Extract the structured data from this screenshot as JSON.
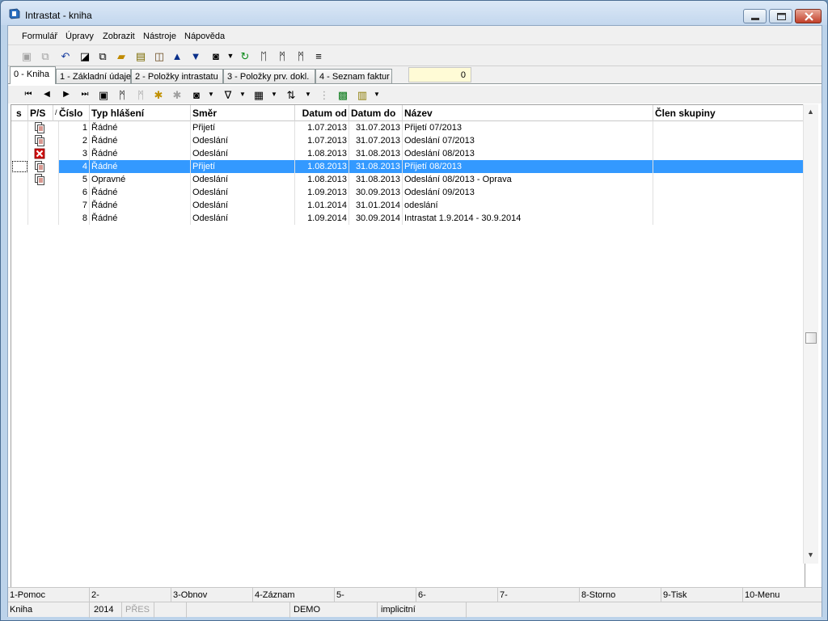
{
  "window": {
    "title": "Intrastat - kniha"
  },
  "menu": [
    "Formulář",
    "Úpravy",
    "Zobrazit",
    "Nástroje",
    "Nápověda"
  ],
  "tabs": [
    {
      "label": "0 - Kniha",
      "active": true
    },
    {
      "label": "1 - Základní údaje",
      "active": false
    },
    {
      "label": "2 - Položky intrastatu",
      "active": false
    },
    {
      "label": "3 - Položky prv. dokl.",
      "active": false
    },
    {
      "label": "4 - Seznam faktur",
      "active": false
    }
  ],
  "record_counter": "0",
  "toolbar_icons": [
    "save-icon",
    "save-all-icon",
    "undo-icon",
    "new-record-icon",
    "copy-record-icon",
    "open-folder-icon",
    "lock-icon",
    "book-icon",
    "arrow-up-icon",
    "arrow-down-icon",
    "camera-icon",
    "dropdown-icon",
    "refresh-icon",
    "binoculars-icon",
    "binoculars-next-icon",
    "binoculars-prev-icon",
    "list-icon"
  ],
  "grid": {
    "columns": [
      "s",
      "P/S",
      "Číslo",
      "Typ hlášení",
      "Směr",
      "Datum od",
      "Datum do",
      "Název",
      "Člen skupiny"
    ],
    "sort_marker": "/",
    "rows": [
      {
        "icon": "document-icon",
        "cislo": "1",
        "typ": "Řádné",
        "smer": "Přijetí",
        "od": "1.07.2013",
        "do": "31.07.2013",
        "nazev": "Přijetí 07/2013",
        "clen": "",
        "selected": false
      },
      {
        "icon": "document-icon",
        "cislo": "2",
        "typ": "Řádné",
        "smer": "Odeslání",
        "od": "1.07.2013",
        "do": "31.07.2013",
        "nazev": "Odeslání 07/2013",
        "clen": "",
        "selected": false
      },
      {
        "icon": "error-icon",
        "cislo": "3",
        "typ": "Řádné",
        "smer": "Odeslání",
        "od": "1.08.2013",
        "do": "31.08.2013",
        "nazev": "Odeslání 08/2013",
        "clen": "",
        "selected": false
      },
      {
        "icon": "document-icon",
        "cislo": "4",
        "typ": "Řádné",
        "smer": "Přijetí",
        "od": "1.08.2013",
        "do": "31.08.2013",
        "nazev": "Přijetí 08/2013",
        "clen": "",
        "selected": true
      },
      {
        "icon": "document-icon",
        "cislo": "5",
        "typ": "Opravné",
        "smer": "Odeslání",
        "od": "1.08.2013",
        "do": "31.08.2013",
        "nazev": "Odeslání 08/2013 - Oprava",
        "clen": "",
        "selected": false
      },
      {
        "icon": "",
        "cislo": "6",
        "typ": "Řádné",
        "smer": "Odeslání",
        "od": "1.09.2013",
        "do": "30.09.2013",
        "nazev": "Odeslání 09/2013",
        "clen": "",
        "selected": false
      },
      {
        "icon": "",
        "cislo": "7",
        "typ": "Řádné",
        "smer": "Odeslání",
        "od": "1.01.2014",
        "do": "31.01.2014",
        "nazev": "odeslání",
        "clen": "",
        "selected": false
      },
      {
        "icon": "",
        "cislo": "8",
        "typ": "Řádné",
        "smer": "Odeslání",
        "od": "1.09.2014",
        "do": "30.09.2014",
        "nazev": " Intrastat 1.9.2014 - 30.9.2014",
        "clen": "",
        "selected": false
      }
    ]
  },
  "function_keys": [
    "1-Pomoc",
    "2-",
    "3-Obnov",
    "4-Záznam",
    "5-",
    "6-",
    "7-",
    "8-Storno",
    "9-Tisk",
    "10-Menu"
  ],
  "status": {
    "form": "Kniha",
    "year": "2014",
    "mode": "PŘES",
    "empty1": "",
    "db": "DEMO",
    "empty2": "",
    "profile": "implicitní"
  },
  "colors": {
    "selection": "#3399ff",
    "counter_bg": "#fffbd6",
    "error": "#d01010"
  }
}
